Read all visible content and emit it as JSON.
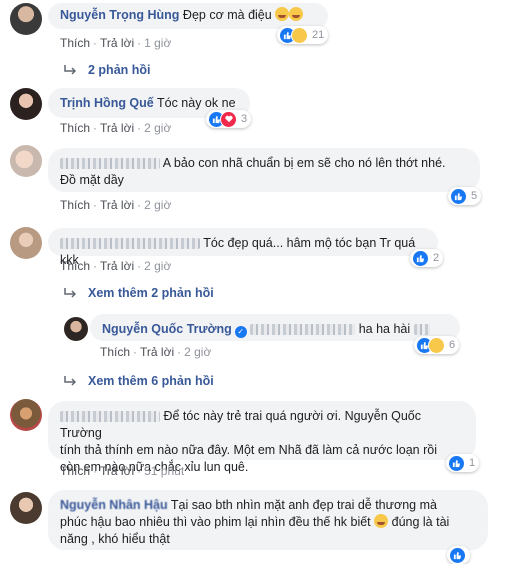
{
  "actions": {
    "like": "Thích",
    "reply": "Trả lời"
  },
  "comments": [
    {
      "name": "Nguyễn Trọng Hùng",
      "text": "Đẹp cơ mà điệu",
      "time": "1 giờ",
      "reaction_count": "21",
      "replies": "2 phản hồi"
    },
    {
      "name": "Trịnh Hồng Quế",
      "text": "Tóc này ok ne",
      "time": "2 giờ",
      "reaction_count": "3"
    },
    {
      "text1": "A bảo con nhã chuẩn bị em sẽ cho nó lên thớt nhé.",
      "text2": "Đồ mặt dầy",
      "time": "2 giờ",
      "reaction_count": "5"
    },
    {
      "text": "Tóc đẹp quá... hâm mộ tóc bạn Tr quá kkk",
      "time": "2 giờ",
      "reaction_count": "2",
      "replies": "Xem thêm 2 phản hồi"
    },
    {
      "name": "Nguyễn Quốc Trường",
      "text": "ha ha hài",
      "time": "2 giờ",
      "reaction_count": "6",
      "replies": "Xem thêm 6 phản hồi"
    },
    {
      "text1": "Để tóc này trẻ trai quá người ơi. Nguyễn Quốc Trường",
      "text2": "tính thả thính em nào nữa đây. Một em Nhã đã làm cả nước loạn rồi",
      "text3": "còn em nào nữa chắc xỉu lun quê.",
      "time": "51 phút",
      "reaction_count": "1"
    },
    {
      "name": "Nguyễn Nhân Hậu",
      "text1": "Tại sao bth nhìn mặt anh đẹp trai dễ thương mà",
      "text2a": "phúc hậu bao nhiêu thì vào phim lại nhìn đều thế hk biết",
      "text2b": "đúng là tài",
      "text3": "năng , khó hiểu thật"
    }
  ],
  "colors": {
    "name": "#385898",
    "bubble": "#f2f3f5",
    "like": "#1877f2"
  }
}
